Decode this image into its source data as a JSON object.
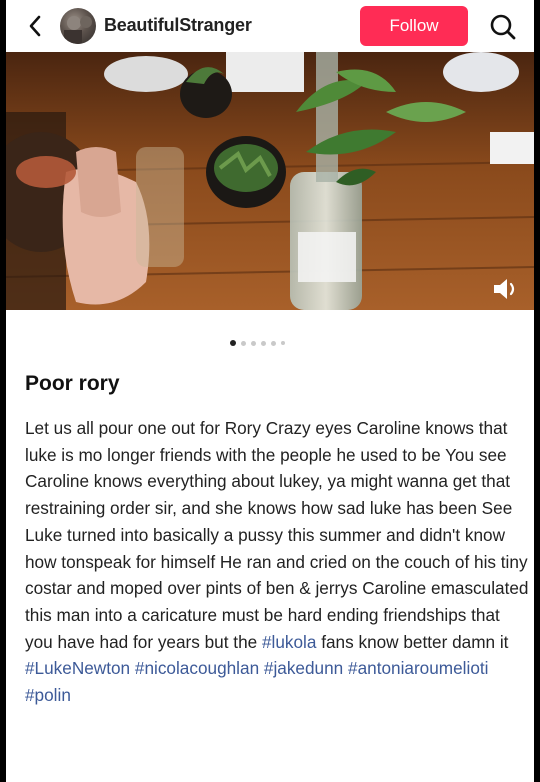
{
  "header": {
    "username": "BeautifulStranger",
    "follow_label": "Follow"
  },
  "carousel": {
    "count": 6,
    "active_index": 0
  },
  "post": {
    "title": "Poor rory",
    "body_text": "Let us all pour one out for Rory Crazy eyes Caroline knows that luke is mo longer friends with the people he used to be You see Caroline knows everything about lukey, ya might wanna get that restraining order sir, and she knows how sad luke has been See Luke turned into basically a pussy this summer and didn't know how tonspeak for himself He ran and cried on the couch of his tiny costar and moped over pints of ben & jerrys Caroline emasculated this man into a caricature must be hard ending friendships that you have had for years but the ",
    "tags": [
      "#lukola",
      "#LukeNewton",
      "#nicolacoughlan",
      "#jakedunn",
      "#antoniaroumelioti",
      "#polin"
    ],
    "text_between_tags": [
      " fans know better damn it ",
      " ",
      " ",
      " ",
      " ",
      ""
    ]
  },
  "colors": {
    "follow": "#ff2c55",
    "hashtag": "#3d5a98"
  },
  "icons": {
    "back": "chevron-left-icon",
    "search": "search-icon",
    "volume": "volume-icon"
  }
}
